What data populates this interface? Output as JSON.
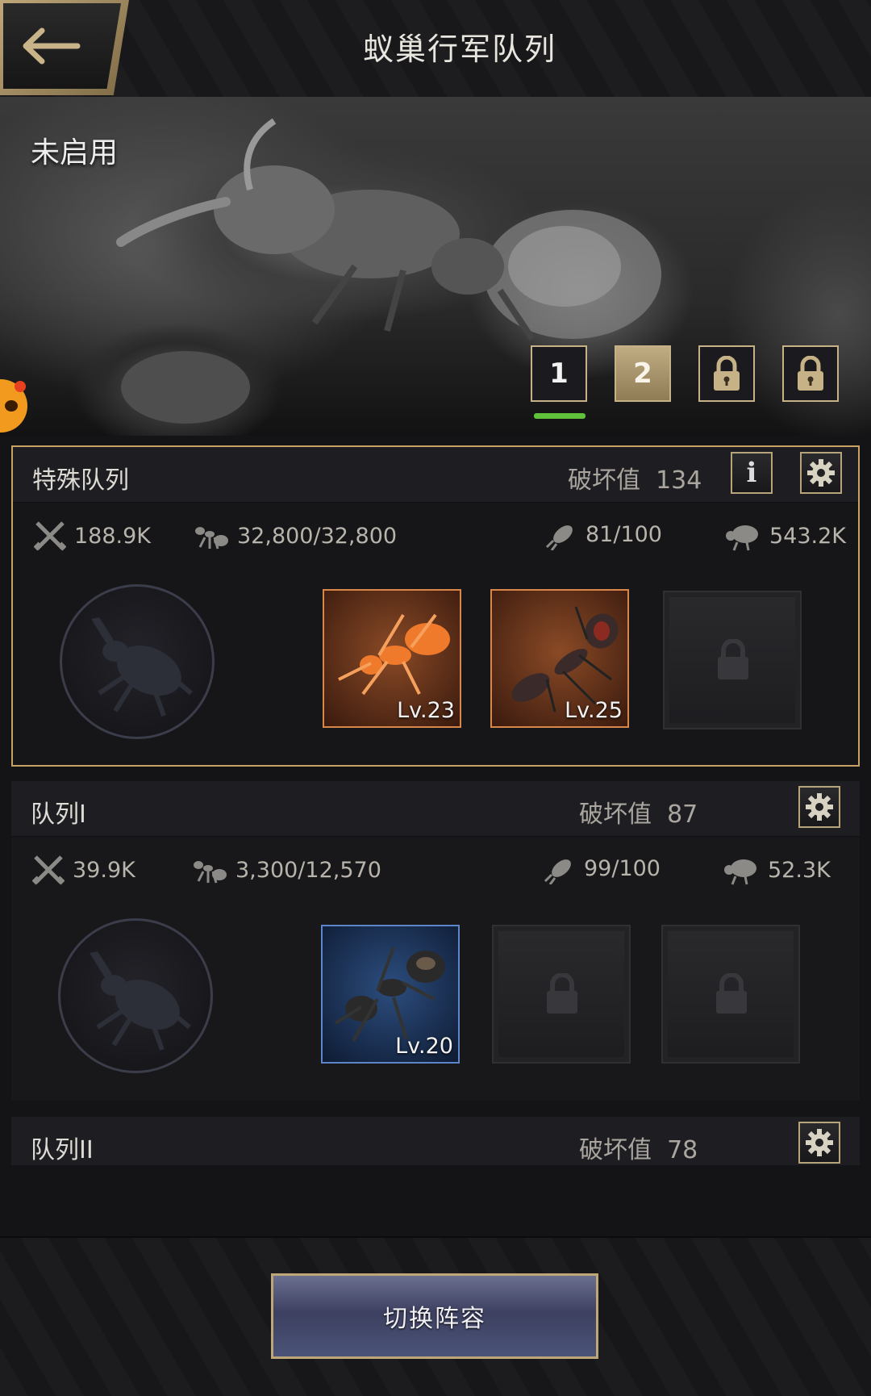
{
  "header": {
    "title": "蚁巢行军队列",
    "back_icon": "back-arrow-icon"
  },
  "banner": {
    "status": "未启用",
    "tabs": [
      {
        "label": "1",
        "state": "selected"
      },
      {
        "label": "2",
        "state": "active"
      },
      {
        "label": "",
        "state": "locked",
        "icon": "lock-icon"
      },
      {
        "label": "",
        "state": "locked",
        "icon": "lock-icon"
      }
    ]
  },
  "squads": [
    {
      "name": "特殊队列",
      "damage_label": "破坏值",
      "damage_value": "134",
      "stats": {
        "attack": "188.9K",
        "troops": "32,800/32,800",
        "load": "81/100",
        "power": "543.2K"
      },
      "slots": [
        {
          "type": "unit",
          "level": "Lv.23",
          "color": "#d8864a"
        },
        {
          "type": "unit",
          "level": "Lv.25",
          "color": "#d8864a"
        },
        {
          "type": "locked"
        }
      ]
    },
    {
      "name": "队列I",
      "damage_label": "破坏值",
      "damage_value": "87",
      "stats": {
        "attack": "39.9K",
        "troops": "3,300/12,570",
        "load": "99/100",
        "power": "52.3K"
      },
      "slots": [
        {
          "type": "unit",
          "level": "Lv.20",
          "color": "#5d86c9"
        },
        {
          "type": "locked"
        },
        {
          "type": "locked"
        }
      ]
    },
    {
      "name": "队列II",
      "damage_label": "破坏值",
      "damage_value": "78"
    }
  ],
  "bottom": {
    "switch_label": "切换阵容"
  },
  "colors": {
    "accent_gold": "#c9a164",
    "tab_indicator": "#5fc23a"
  }
}
